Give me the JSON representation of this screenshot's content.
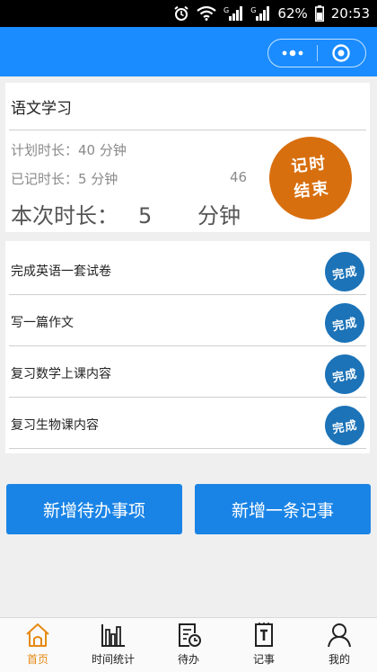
{
  "status_bar": {
    "network_label_1": "G",
    "network_label_2": "G",
    "battery": "62%",
    "time": "20:53"
  },
  "session": {
    "subject": "语文学习",
    "plan_text": "计划时长：40 分钟",
    "logged_text": "已记时长：5 分钟",
    "seconds": "46",
    "current_label": "本次时长：",
    "current_value": "5",
    "current_unit": "分钟",
    "stop_line1": "记时",
    "stop_line2": "结束"
  },
  "todos": [
    {
      "text": "完成英语一套试卷",
      "stamp": "完成"
    },
    {
      "text": "写一篇作文",
      "stamp": "完成"
    },
    {
      "text": "复习数学上课内容",
      "stamp": "完成"
    },
    {
      "text": "复习生物课内容",
      "stamp": "完成"
    }
  ],
  "actions": {
    "add_todo": "新增待办事项",
    "add_note": "新增一条记事"
  },
  "tabs": [
    {
      "label": "首页",
      "icon": "home-icon",
      "active": true
    },
    {
      "label": "时间统计",
      "icon": "bar-chart-icon",
      "active": false
    },
    {
      "label": "待办",
      "icon": "todo-clock-icon",
      "active": false
    },
    {
      "label": "记事",
      "icon": "note-icon",
      "active": false
    },
    {
      "label": "我的",
      "icon": "user-icon",
      "active": false
    }
  ],
  "colors": {
    "nav_blue": "#1a8cff",
    "stop_orange": "#d86f0f",
    "stamp_blue": "#1c73b8",
    "button_blue": "#1a84e6",
    "tab_active": "#e58a13"
  }
}
